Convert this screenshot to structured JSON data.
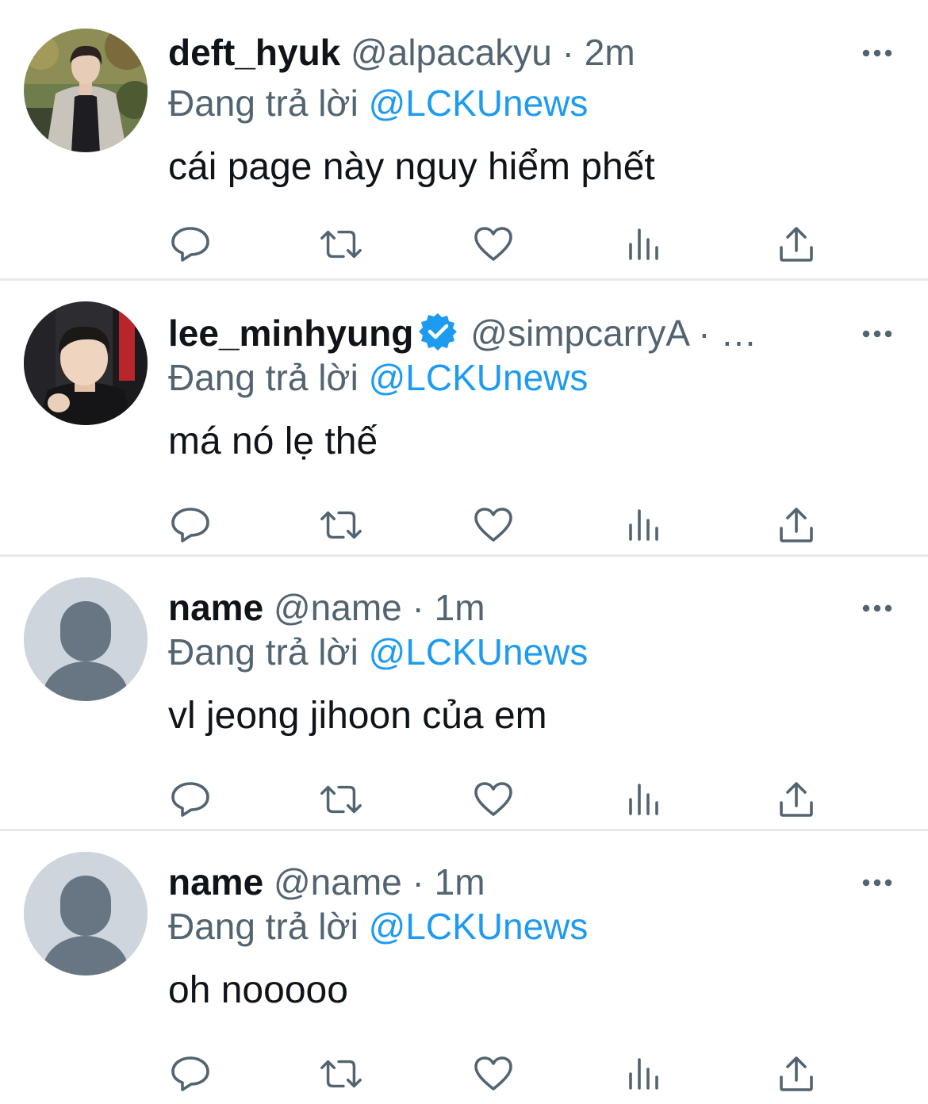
{
  "colors": {
    "text_primary": "#0f1419",
    "text_secondary": "#536471",
    "link_blue": "#1d9bf0",
    "divider": "#e7e9ea",
    "default_avatar_bg": "#ced5dc",
    "default_avatar_fg": "#687684"
  },
  "reply_prefix": "Đang trả lời",
  "icons": {
    "more": "more-horizontal-icon",
    "reply": "reply-bubble-icon",
    "retweet": "retweet-icon",
    "like": "heart-icon",
    "views": "bar-chart-icon",
    "share": "share-upload-icon",
    "verified": "verified-badge-icon"
  },
  "tweets": [
    {
      "display_name": "deft_hyuk",
      "handle": "@alpacakyu",
      "separator": "·",
      "time": "2m",
      "reply_to": "@LCKUnews",
      "text": "cái page này nguy hiểm phết",
      "avatar": "photo-avatar",
      "verified": false
    },
    {
      "display_name": "lee_minhyung",
      "handle": "@simpcarryA",
      "separator": "·",
      "time": "…",
      "reply_to": "@LCKUnews",
      "text": "má nó lẹ thế",
      "avatar": "photo-avatar",
      "verified": true
    },
    {
      "display_name": "name",
      "handle": "@name",
      "separator": "·",
      "time": "1m",
      "reply_to": "@LCKUnews",
      "text": "vl jeong jihoon của em",
      "avatar": "default-avatar",
      "verified": false
    },
    {
      "display_name": "name",
      "handle": "@name",
      "separator": "·",
      "time": "1m",
      "reply_to": "@LCKUnews",
      "text": "oh nooooo",
      "avatar": "default-avatar",
      "verified": false
    }
  ]
}
